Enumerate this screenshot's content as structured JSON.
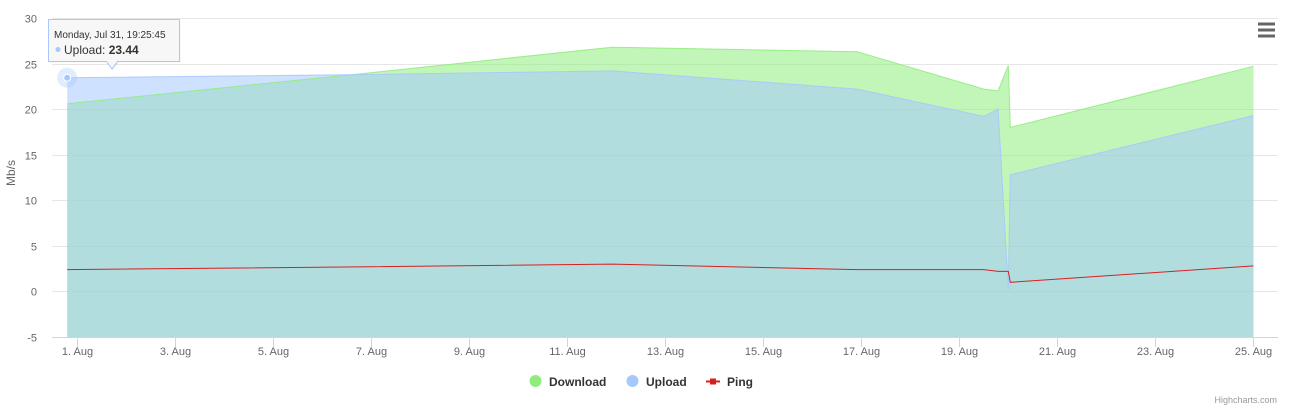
{
  "chart_data": {
    "type": "area",
    "ylabel": "Mb/s",
    "ylim": [
      -5,
      30
    ],
    "y_ticks": [
      -5,
      0,
      5,
      10,
      15,
      20,
      25,
      30
    ],
    "x_tick_labels": [
      "1. Aug",
      "3. Aug",
      "5. Aug",
      "7. Aug",
      "9. Aug",
      "11. Aug",
      "13. Aug",
      "15. Aug",
      "17. Aug",
      "19. Aug",
      "21. Aug",
      "23. Aug",
      "25. Aug"
    ],
    "x_tick_dates": [
      "2023-08-01",
      "2023-08-03",
      "2023-08-05",
      "2023-08-07",
      "2023-08-09",
      "2023-08-11",
      "2023-08-13",
      "2023-08-15",
      "2023-08-17",
      "2023-08-19",
      "2023-08-21",
      "2023-08-23",
      "2023-08-25"
    ],
    "x_range": [
      "2023-07-31 12:00",
      "2023-08-25 12:00"
    ],
    "grid": true,
    "legend_placement": "bottom-center",
    "series": [
      {
        "name": "Download",
        "type": "area",
        "color": "#90ed7d",
        "points": [
          [
            "2023-07-31 19:25",
            20.6
          ],
          [
            "2023-08-07 00:00",
            24.0
          ],
          [
            "2023-08-11 22:00",
            26.8
          ],
          [
            "2023-08-16 22:00",
            26.3
          ],
          [
            "2023-08-19 12:00",
            22.2
          ],
          [
            "2023-08-19 19:00",
            22.0
          ],
          [
            "2023-08-20 00:00",
            24.8
          ],
          [
            "2023-08-20 01:00",
            18.0
          ],
          [
            "2023-08-25 00:00",
            24.7
          ]
        ]
      },
      {
        "name": "Upload",
        "type": "area",
        "color": "#a6c8ff",
        "points": [
          [
            "2023-07-31 19:25",
            23.44
          ],
          [
            "2023-08-07 00:00",
            23.8
          ],
          [
            "2023-08-11 22:00",
            24.2
          ],
          [
            "2023-08-16 22:00",
            22.2
          ],
          [
            "2023-08-19 12:00",
            19.2
          ],
          [
            "2023-08-19 19:00",
            20.0
          ],
          [
            "2023-08-20 00:00",
            0.2
          ],
          [
            "2023-08-20 01:00",
            12.8
          ],
          [
            "2023-08-25 00:00",
            19.3
          ]
        ]
      },
      {
        "name": "Ping",
        "type": "line",
        "color": "#d62020",
        "points": [
          [
            "2023-07-31 19:25",
            2.4
          ],
          [
            "2023-08-07 00:00",
            2.7
          ],
          [
            "2023-08-11 22:00",
            3.0
          ],
          [
            "2023-08-16 22:00",
            2.4
          ],
          [
            "2023-08-19 12:00",
            2.4
          ],
          [
            "2023-08-19 19:00",
            2.2
          ],
          [
            "2023-08-20 00:00",
            2.2
          ],
          [
            "2023-08-20 01:00",
            1.0
          ],
          [
            "2023-08-25 00:00",
            2.8
          ]
        ]
      }
    ],
    "legend": [
      {
        "name": "Download",
        "symbol": "circle",
        "color": "#90ed7d"
      },
      {
        "name": "Upload",
        "symbol": "circle",
        "color": "#a6c8ff"
      },
      {
        "name": "Ping",
        "symbol": "line-square",
        "color": "#d62020"
      }
    ],
    "tooltip": {
      "title": "Monday, Jul 31, 19:25:45",
      "series": "Upload",
      "label": "Upload: ",
      "value": "23.44"
    },
    "credits": "Highcharts.com",
    "menu_icon": "hamburger-menu-icon"
  }
}
